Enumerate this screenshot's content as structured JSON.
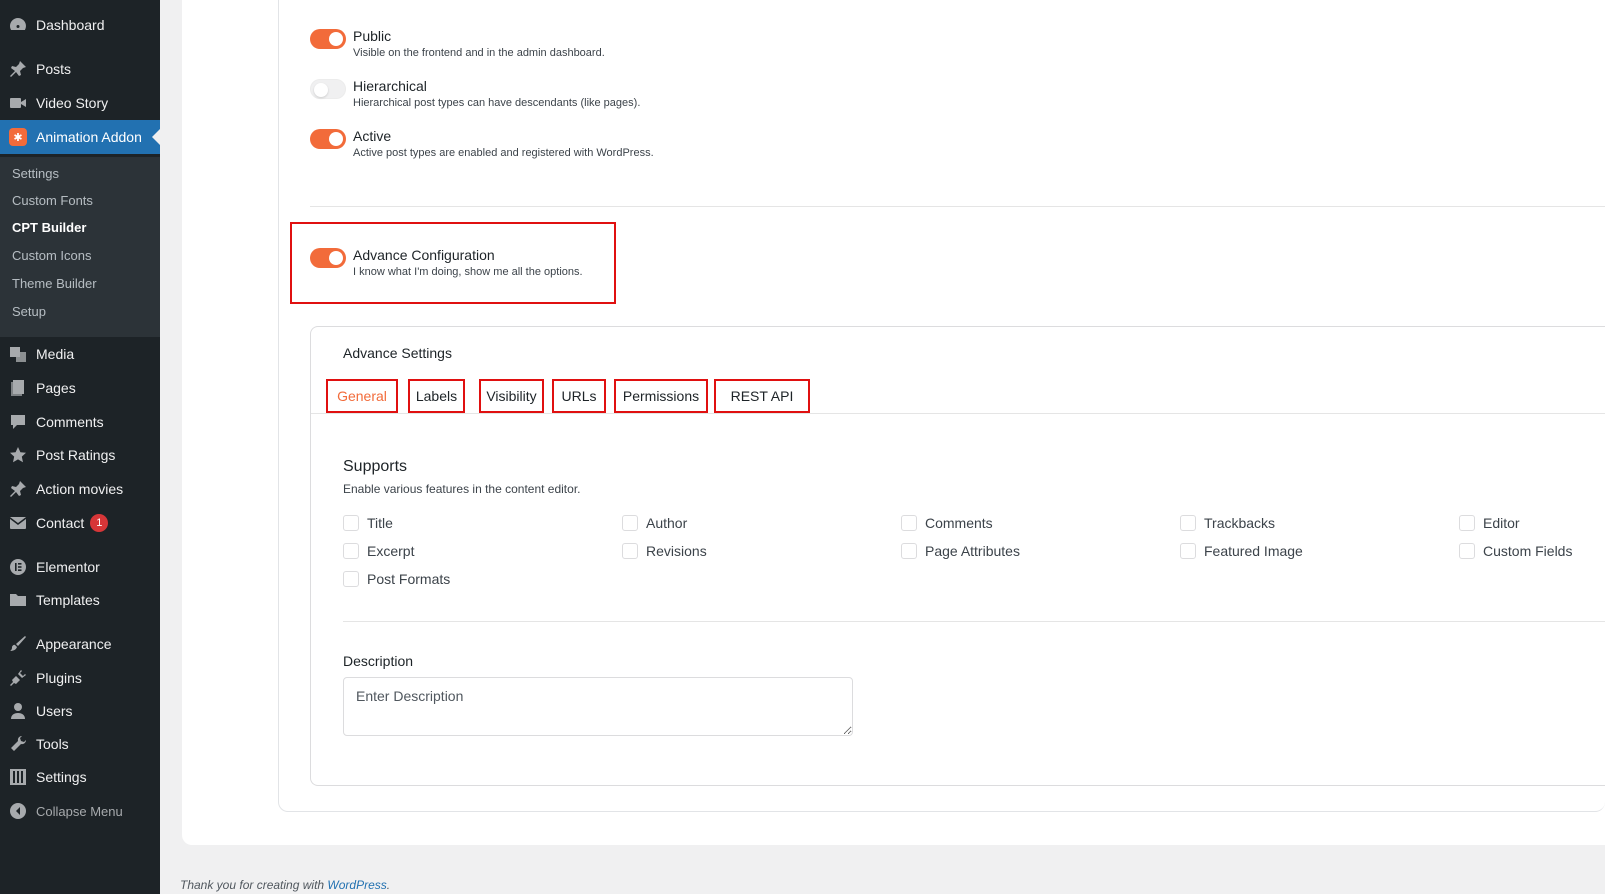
{
  "sidebar": {
    "items": [
      {
        "label": "Dashboard",
        "icon": "dashboard-icon"
      },
      {
        "label": "Posts",
        "icon": "pin-icon"
      },
      {
        "label": "Video Story",
        "icon": "video-icon"
      },
      {
        "label": "Animation Addon",
        "icon": "animation-addon-icon"
      },
      {
        "label": "Media",
        "icon": "media-icon"
      },
      {
        "label": "Pages",
        "icon": "pages-icon"
      },
      {
        "label": "Comments",
        "icon": "comments-icon"
      },
      {
        "label": "Post Ratings",
        "icon": "star-icon"
      },
      {
        "label": "Action movies",
        "icon": "pin-icon"
      },
      {
        "label": "Contact",
        "icon": "mail-icon",
        "badge": "1"
      },
      {
        "label": "Elementor",
        "icon": "elementor-icon"
      },
      {
        "label": "Templates",
        "icon": "folder-icon"
      },
      {
        "label": "Appearance",
        "icon": "brush-icon"
      },
      {
        "label": "Plugins",
        "icon": "plugin-icon"
      },
      {
        "label": "Users",
        "icon": "users-icon"
      },
      {
        "label": "Tools",
        "icon": "wrench-icon"
      },
      {
        "label": "Settings",
        "icon": "settings-icon"
      },
      {
        "label": "Collapse Menu",
        "icon": "collapse-icon"
      }
    ],
    "submenu": [
      "Settings",
      "Custom Fonts",
      "CPT Builder",
      "Custom Icons",
      "Theme Builder",
      "Setup"
    ]
  },
  "options": [
    {
      "title": "Public",
      "desc": "Visible on the frontend and in the admin dashboard.",
      "on": true
    },
    {
      "title": "Hierarchical",
      "desc": "Hierarchical post types can have descendants (like pages).",
      "on": false
    },
    {
      "title": "Active",
      "desc": "Active post types are enabled and registered with WordPress.",
      "on": true
    }
  ],
  "advance": {
    "title": "Advance Configuration",
    "desc": "I know what I'm doing, show me all the options.",
    "on": true
  },
  "card": {
    "title": "Advance Settings",
    "tabs": [
      "General",
      "Labels",
      "Visibility",
      "URLs",
      "Permissions",
      "REST API"
    ],
    "supports_title": "Supports",
    "supports_desc": "Enable various features in the content editor.",
    "supports": [
      "Title",
      "Author",
      "Comments",
      "Trackbacks",
      "Editor",
      "Excerpt",
      "Revisions",
      "Page Attributes",
      "Featured Image",
      "Custom Fields",
      "Post Formats"
    ],
    "description_label": "Description",
    "description_placeholder": "Enter Description"
  },
  "footer": {
    "text": "Thank you for creating with ",
    "link": "WordPress",
    "end": "."
  },
  "colors": {
    "accent": "#f26b3a",
    "wp_blue": "#2271b1",
    "highlight_red": "#e01010"
  }
}
